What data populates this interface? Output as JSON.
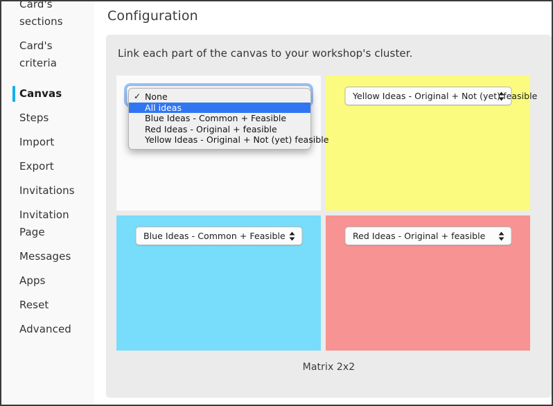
{
  "sidebar": {
    "items": [
      {
        "label": "Card's sections",
        "active": false,
        "two_line": true
      },
      {
        "label": "Card's criteria",
        "active": false,
        "two_line": true
      },
      {
        "label": "Canvas",
        "active": true,
        "two_line": false
      },
      {
        "label": "Steps",
        "active": false,
        "two_line": false
      },
      {
        "label": "Import",
        "active": false,
        "two_line": false
      },
      {
        "label": "Export",
        "active": false,
        "two_line": false
      },
      {
        "label": "Invitations",
        "active": false,
        "two_line": false
      },
      {
        "label": "Invitation Page",
        "active": false,
        "two_line": true
      },
      {
        "label": "Messages",
        "active": false,
        "two_line": false
      },
      {
        "label": "Apps",
        "active": false,
        "two_line": false
      },
      {
        "label": "Reset",
        "active": false,
        "two_line": false
      },
      {
        "label": "Advanced",
        "active": false,
        "two_line": false
      }
    ],
    "active_accent_color": "#12b0e8",
    "item_labels": {
      "0": "Card's sections",
      "1": "Card's criteria",
      "2": "Canvas",
      "3": "Steps",
      "4": "Import",
      "5": "Export",
      "6": "Invitations",
      "7": "Invitation Page",
      "8": "Messages",
      "9": "Apps",
      "10": "Reset",
      "11": "Advanced"
    }
  },
  "header": {
    "title": "Configuration"
  },
  "panel": {
    "instruction": "Link each part of the canvas to your workshop's cluster.",
    "caption": "Matrix 2x2"
  },
  "canvas": {
    "quadrants": [
      {
        "name": "top-left",
        "color": "#fbfbfc",
        "selected_value": "All ideas",
        "open": true
      },
      {
        "name": "top-right",
        "color": "#fbfb7f",
        "selected_value": "Yellow Ideas - Original + Not (yet) feasible",
        "open": false
      },
      {
        "name": "bottom-left",
        "color": "#78dcfb",
        "selected_value": "Blue Ideas - Common + Feasible",
        "open": false
      },
      {
        "name": "bottom-right",
        "color": "#f79393",
        "selected_value": "Red Ideas - Original + feasible",
        "open": false
      }
    ],
    "select_values": {
      "top_right": "Yellow Ideas - Original + Not (yet) feasible",
      "bottom_left": "Blue Ideas - Common + Feasible",
      "bottom_right": "Red Ideas - Original + feasible"
    }
  },
  "dropdown": {
    "open": true,
    "highlight_color": "#3076f3",
    "checkmark": "✓",
    "options": [
      {
        "label": "None",
        "checked": true,
        "highlighted": false
      },
      {
        "label": "All ideas",
        "checked": false,
        "highlighted": true
      },
      {
        "label": "Blue Ideas - Common + Feasible",
        "checked": false,
        "highlighted": false
      },
      {
        "label": "Red Ideas - Original + feasible",
        "checked": false,
        "highlighted": false
      },
      {
        "label": "Yellow Ideas - Original + Not (yet) feasible",
        "checked": false,
        "highlighted": false
      }
    ],
    "option_labels": {
      "0": "None",
      "1": "All ideas",
      "2": "Blue Ideas - Common + Feasible",
      "3": "Red Ideas - Original + feasible",
      "4": "Yellow Ideas - Original + Not (yet) feasible"
    }
  }
}
